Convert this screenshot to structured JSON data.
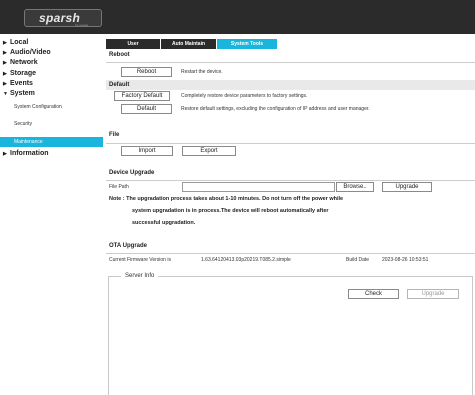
{
  "brand": {
    "logo_text": "sparsh",
    "logo_sub": "for people"
  },
  "sidebar": {
    "items": [
      {
        "label": "Local",
        "arrow": "▶"
      },
      {
        "label": "Audio/Video",
        "arrow": "▶"
      },
      {
        "label": "Network",
        "arrow": "▶"
      },
      {
        "label": "Storage",
        "arrow": "▶"
      },
      {
        "label": "Events",
        "arrow": "▶"
      },
      {
        "label": "System",
        "arrow": "▼"
      },
      {
        "label": "Information",
        "arrow": "▶"
      }
    ],
    "system_sub": [
      "System Configuration",
      "Security",
      "Maintenance"
    ]
  },
  "tabs": [
    "User",
    "Auto Maintain",
    "System Tools"
  ],
  "reboot": {
    "title": "Reboot",
    "button": "Reboot",
    "desc": "Restart the device."
  },
  "default": {
    "title": "Default",
    "factory_button": "Factory Default",
    "factory_desc": "Completely restore device parameters to factory settings.",
    "default_button": "Default",
    "default_desc": "Restore default settings, excluding the configuration of IP address and user manager."
  },
  "file": {
    "title": "File",
    "import_button": "Import",
    "export_button": "Export"
  },
  "upgrade": {
    "title": "Device Upgrade",
    "file_path_label": "File Path",
    "file_path_value": "",
    "browse_button": "Browse..",
    "upgrade_button": "Upgrade",
    "note_line1": "Note :  The upgradation process takes about 1-10 minutes. Do not turn off the power while",
    "note_line2": "system upgradation is in process.The device will reboot automatically after",
    "note_line3": "successful upgradation."
  },
  "ota": {
    "title": "OTA Upgrade",
    "fw_label": "Current Firmware Version is",
    "fw_value": "1.63.64120413.03p20219.T085.2.simple",
    "build_label": "Build Date",
    "build_value": "2023-08-26 10:53:51",
    "server_legend": "Server Info",
    "check_button": "Check",
    "upgrade_button": "Upgrade"
  }
}
